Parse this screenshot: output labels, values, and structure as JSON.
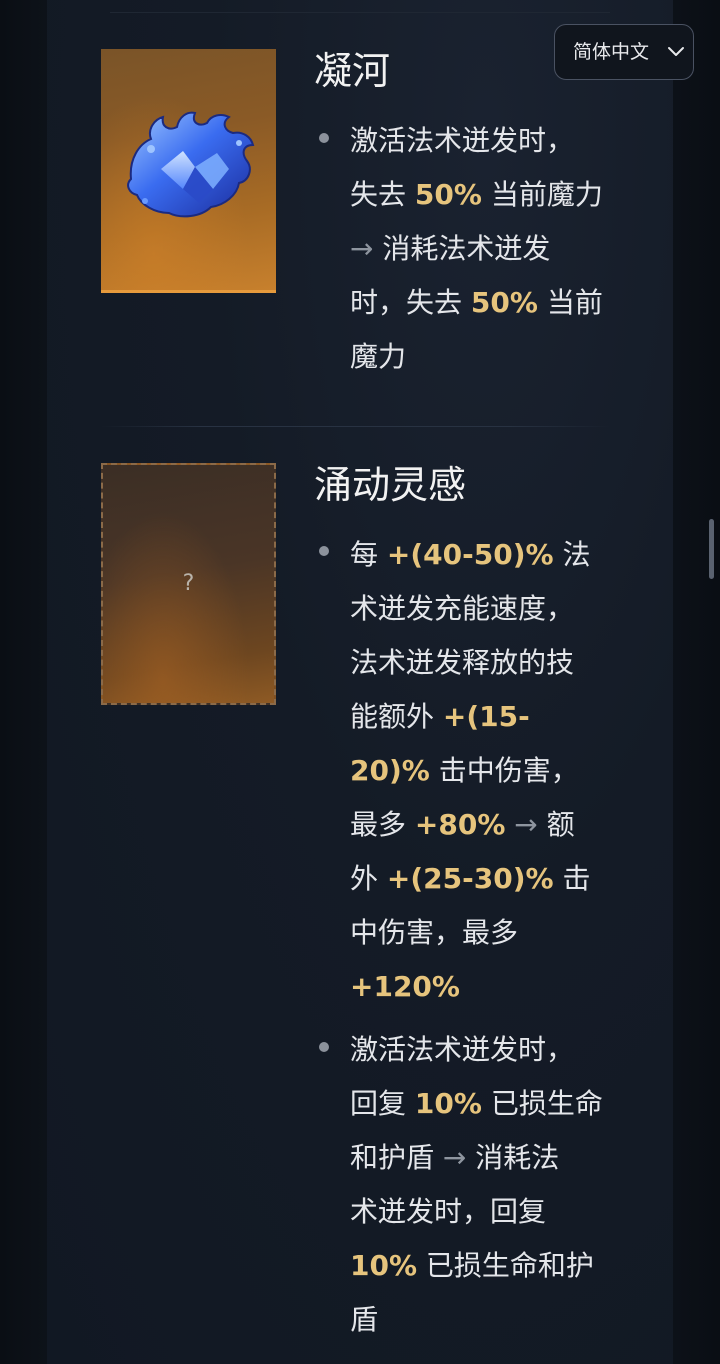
{
  "language_switcher": {
    "label": "简体中文",
    "icon": "chevron-down-icon"
  },
  "items": [
    {
      "name": "凝河",
      "image": "blue-crystal-mask-icon",
      "bullets": [
        {
          "lines": [
            [
              "激活法术迸发时，"
            ],
            [
              "失去 ",
              "50%",
              " 当前魔力"
            ],
            [
              " → ",
              " 消耗法术迸发"
            ],
            [
              "时，失去 ",
              "50%",
              " 当前"
            ],
            [
              "魔力"
            ]
          ]
        }
      ]
    },
    {
      "name": "涌动灵感",
      "image_placeholder": "?",
      "bullets": [
        {
          "lines": [
            [
              "每 ",
              "+(40-50)%",
              " 法"
            ],
            [
              "术迸发充能速度，"
            ],
            [
              "法术迸发释放的技"
            ],
            [
              "能额外 ",
              "+(15-"
            ],
            [
              "",
              "20)%",
              " 击中伤害，"
            ],
            [
              "最多 ",
              "+80%",
              " → ",
              " 额"
            ],
            [
              "外 ",
              "+(25-30)%",
              " 击"
            ],
            [
              "中伤害，最多"
            ],
            [
              "",
              "+120%"
            ]
          ]
        },
        {
          "lines": [
            [
              "激活法术迸发时，"
            ],
            [
              "回复 ",
              "10%",
              " 已损生命"
            ],
            [
              "和护盾",
              " → ",
              " 消耗法"
            ],
            [
              "术迸发时，回复"
            ],
            [
              "",
              "10%",
              " 已损生命和护"
            ],
            [
              "盾"
            ]
          ]
        }
      ]
    }
  ],
  "colors": {
    "highlight": "#e6c47d",
    "text": "#e4e6ea",
    "background": "#141b26",
    "card_accent": "#e69a3c"
  }
}
